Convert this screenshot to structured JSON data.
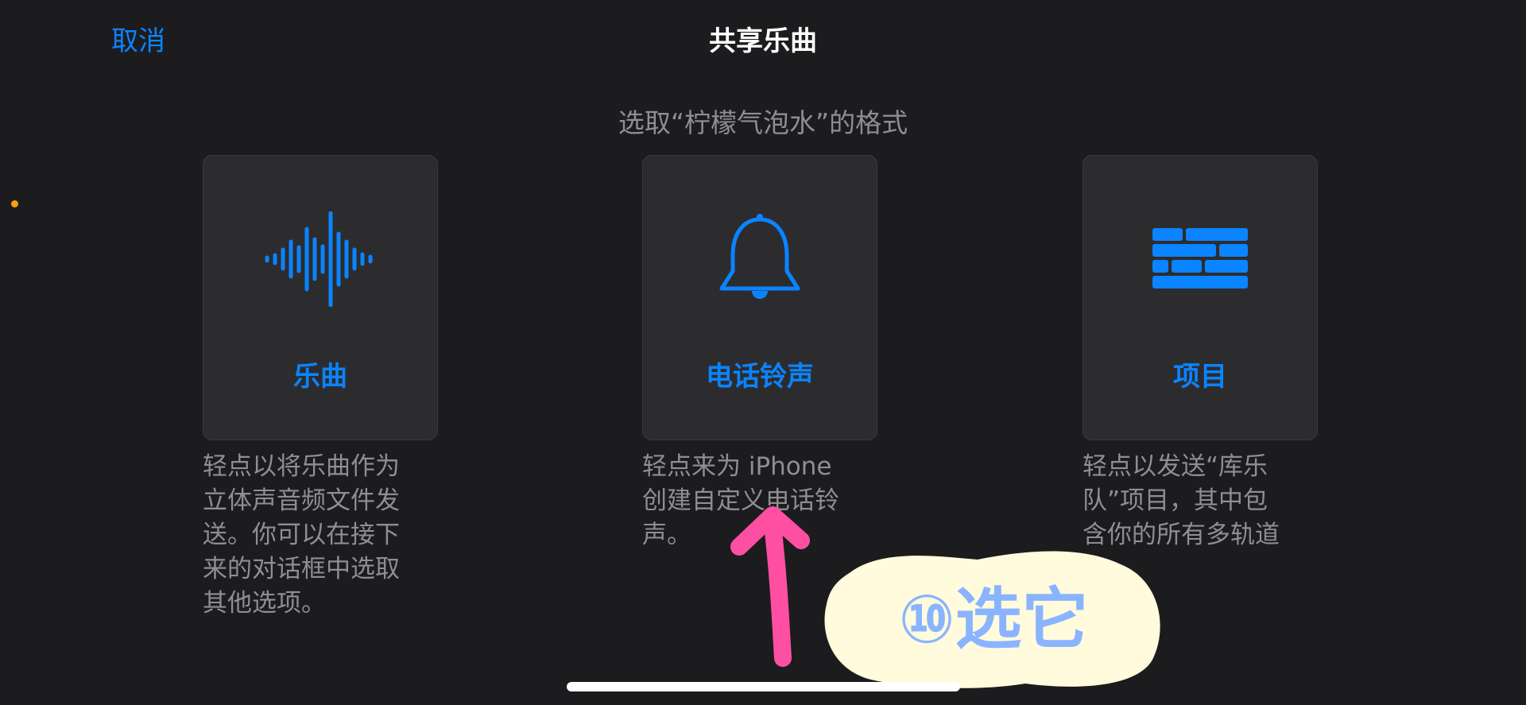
{
  "nav": {
    "cancel_label": "取消",
    "title": "共享乐曲"
  },
  "prompt": "选取“柠檬气泡水”的格式",
  "accent_color": "#0a84ff",
  "options": [
    {
      "icon": "waveform-icon",
      "label": "乐曲",
      "desc_lines": [
        "轻点以将乐曲作为",
        "立体声音频文件发",
        "送。你可以在接下",
        "来的对话框中选取",
        "其他选项。"
      ]
    },
    {
      "icon": "bell-icon",
      "label": "电话铃声",
      "desc_lines": [
        "轻点来为 iPhone",
        "创建自定义电话铃",
        "声。"
      ]
    },
    {
      "icon": "bricks-icon",
      "label": "项目",
      "desc_lines": [
        "轻点以发送“库乐",
        "队”项目，其中包",
        "含你的所有多轨道"
      ]
    }
  ],
  "annotation": {
    "sticker_text": "⑩选它",
    "arrow_color": "#ff4fa3",
    "sticker_bg": "#fffbdc",
    "sticker_text_color": "#8ab4ff"
  }
}
